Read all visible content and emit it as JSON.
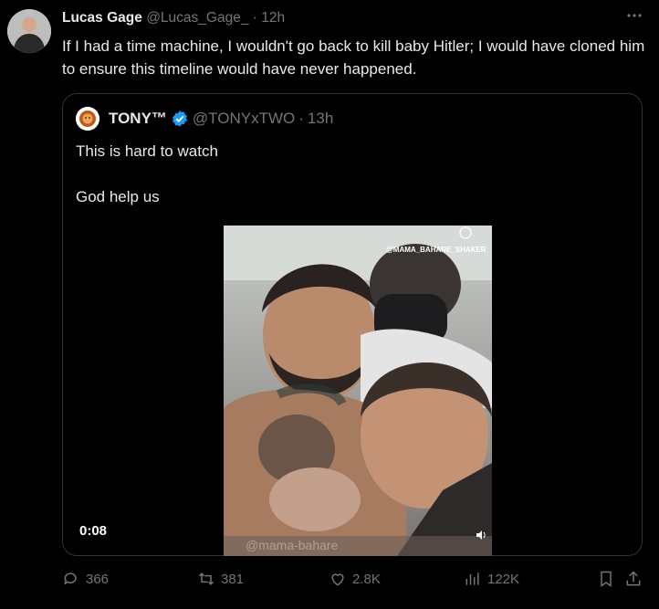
{
  "tweet": {
    "author_name": "Lucas Gage",
    "handle": "@Lucas_Gage_",
    "separator": "·",
    "time": "12h",
    "text": "If I had a time machine, I wouldn't go back to kill baby Hitler; I would have cloned him to ensure this timeline would have never happened.",
    "more_icon": "more-horizontal-icon"
  },
  "quote": {
    "author_name": "TONY™",
    "handle": "@TONYxTWO",
    "separator": "·",
    "time": "13h",
    "text": "This is hard to watch\n\nGod help us",
    "video": {
      "duration": "0:08",
      "watermark_top": "@MAMA_BAHARE_SHAKER",
      "watermark_bottom": "@mama-bahare"
    }
  },
  "actions": {
    "replies": "366",
    "reposts": "381",
    "likes": "2.8K",
    "views": "122K"
  },
  "colors": {
    "background": "#000000",
    "text": "#e7e9ea",
    "muted": "#71767b",
    "border": "#2f3336",
    "verified": "#1d9bf0"
  }
}
